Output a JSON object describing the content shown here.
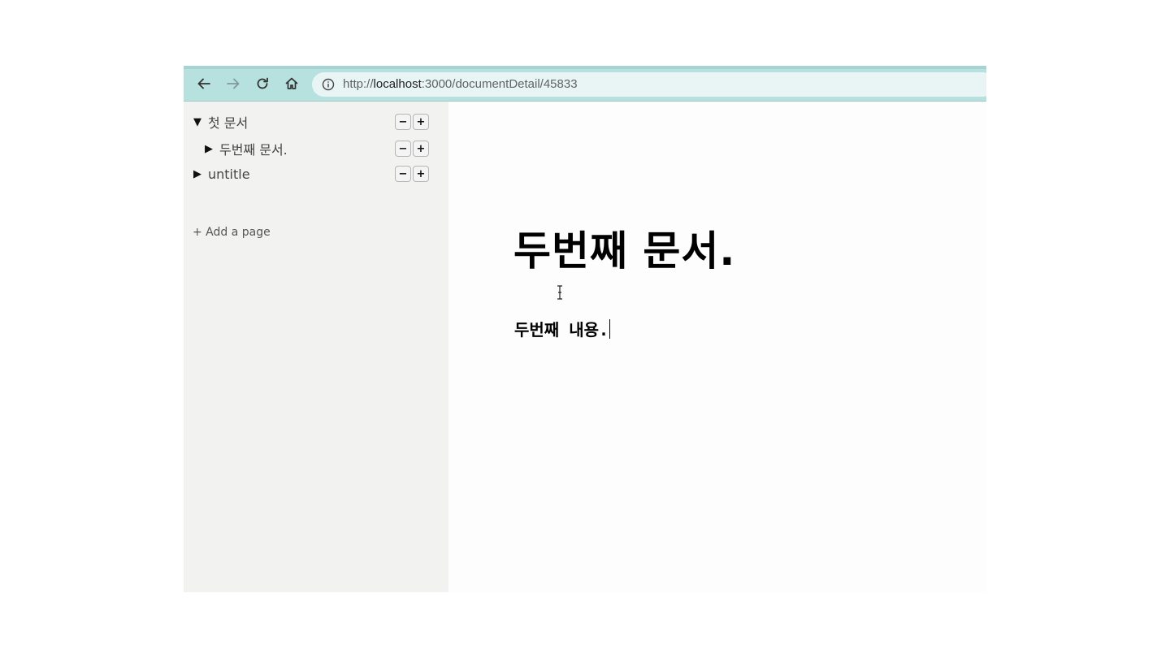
{
  "browser": {
    "url_prefix": "http://",
    "url_host": "localhost",
    "url_rest": ":3000/documentDetail/45833",
    "icons": {
      "back": "arrow-left-icon",
      "forward": "arrow-right-icon",
      "reload": "reload-icon",
      "home": "home-icon",
      "site_info": "info-icon"
    }
  },
  "sidebar": {
    "documents": [
      {
        "toggle": "▼",
        "label": "첫 문서",
        "remove": "−",
        "add": "+"
      },
      {
        "toggle": "▶",
        "label": "두번째 문서.",
        "remove": "−",
        "add": "+"
      },
      {
        "toggle": "▶",
        "label": "untitle",
        "remove": "−",
        "add": "+"
      }
    ],
    "add_page": "+ Add a page"
  },
  "editor": {
    "title": "두번째 문서.",
    "content": "두번째 내용."
  },
  "colors": {
    "toolbar": "#b7e1df",
    "address_bar": "#e8f5f4",
    "sidebar": "#f2f2f1"
  }
}
